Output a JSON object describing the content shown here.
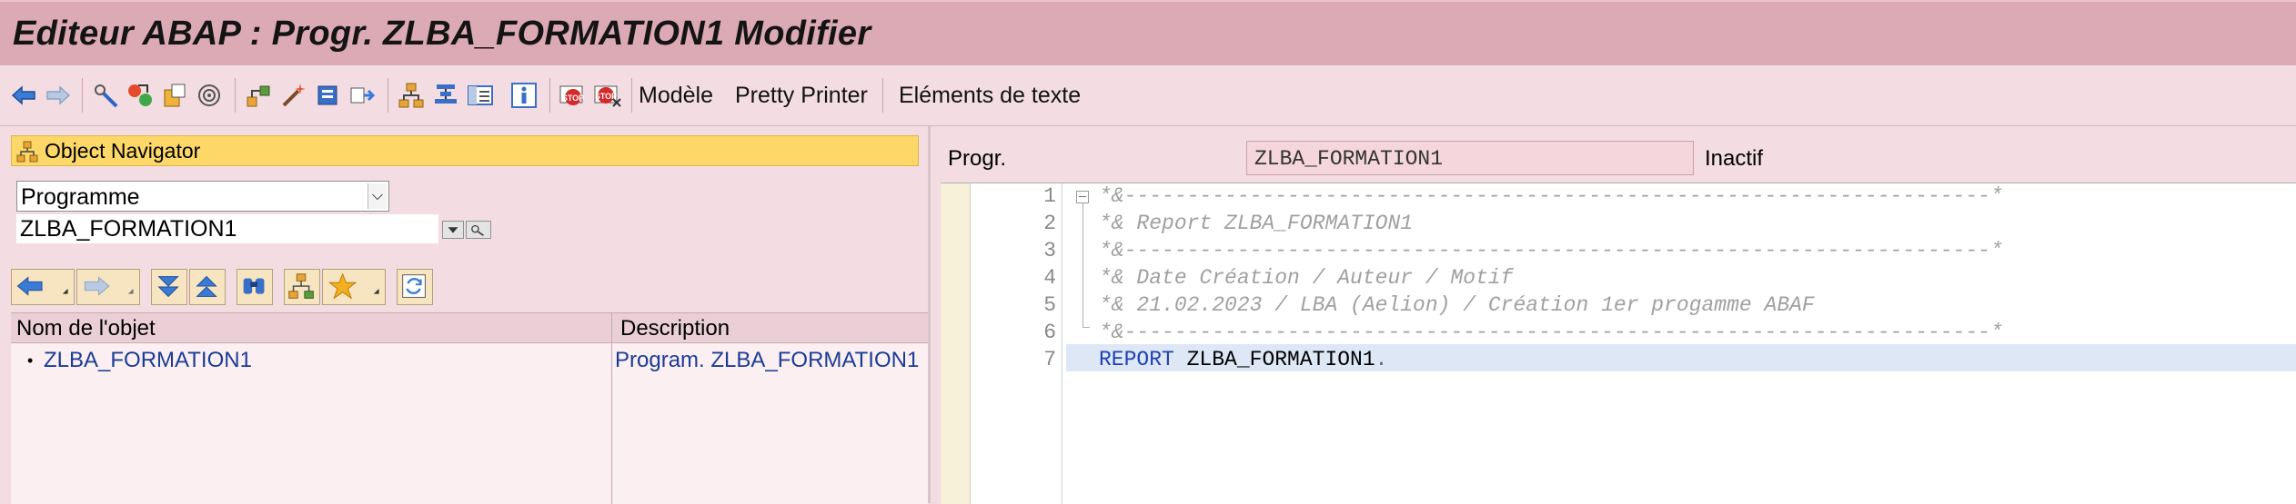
{
  "window": {
    "title": "Editeur ABAP : Progr. ZLBA_FORMATION1 Modifier"
  },
  "toolbar": {
    "modele_label": "Modèle",
    "pretty_printer_label": "Pretty Printer",
    "elements_texte_label": "Eléments de texte"
  },
  "navigator": {
    "title": "Object Navigator",
    "object_type": "Programme",
    "object_name": "ZLBA_FORMATION1",
    "columns": [
      "Nom de l'objet",
      "Description"
    ],
    "rows": [
      {
        "bullet": "•",
        "name": "ZLBA_FORMATION1",
        "description": "Program. ZLBA_FORMATION1"
      }
    ]
  },
  "header": {
    "progr_label": "Progr.",
    "progr_value": "ZLBA_FORMATION1",
    "status": "Inactif"
  },
  "editor": {
    "line_numbers": [
      "1",
      "2",
      "3",
      "4",
      "5",
      "6",
      "7"
    ],
    "comment_lines": [
      "*&---------------------------------------------------------------------*",
      "*& Report ZLBA_FORMATION1",
      "*&---------------------------------------------------------------------*",
      "*& Date Création / Auteur / Motif",
      "*& 21.02.2023 / LBA (Aelion) / Création 1er progamme ABAF",
      "*&---------------------------------------------------------------------*"
    ],
    "statement_keyword": "REPORT",
    "statement_rest": " ZLBA_FORMATION1",
    "statement_end": "."
  },
  "colors": {
    "title_bar": "#dcaab5",
    "background": "#f3dde2",
    "navigator_header": "#fdd868",
    "link_text": "#1b3c96",
    "keyword": "#1f3fb5",
    "current_line": "#dde7f5"
  }
}
